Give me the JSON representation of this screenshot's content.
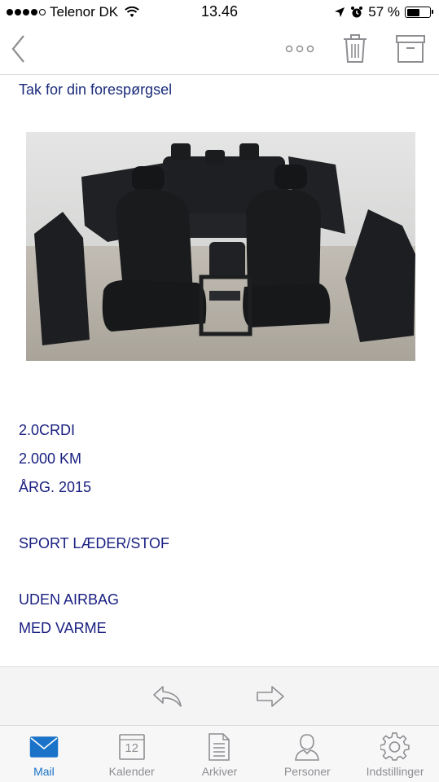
{
  "status": {
    "carrier": "Telenor DK",
    "time": "13.46",
    "battery_percent": "57 %",
    "battery_level": 0.57,
    "signal_bars": 4
  },
  "nav": {
    "back_icon": "chevron-left-icon",
    "more_icon": "more-dots-icon",
    "trash_icon": "trash-icon",
    "archive_icon": "archive-box-icon"
  },
  "message": {
    "subject": "Tak for din forespørgsel",
    "lines": [
      "2.0CRDI",
      "2.000 KM",
      "ÅRG. 2015",
      "SPORT LÆDER/STOF",
      "UDEN AIRBAG",
      "MED VARME"
    ]
  },
  "actions": {
    "reply_icon": "reply-arrow-icon",
    "forward_icon": "forward-arrow-icon"
  },
  "tabs": [
    {
      "label": "Mail",
      "icon": "mail-icon",
      "active": true
    },
    {
      "label": "Kalender",
      "icon": "calendar-icon",
      "day": "12",
      "active": false
    },
    {
      "label": "Arkiver",
      "icon": "document-icon",
      "active": false
    },
    {
      "label": "Personer",
      "icon": "person-icon",
      "active": false
    },
    {
      "label": "Indstillinger",
      "icon": "gear-icon",
      "active": false
    }
  ],
  "colors": {
    "accent": "#1a73c8",
    "text_blue": "#1a2080",
    "inactive": "#8e8e93"
  }
}
